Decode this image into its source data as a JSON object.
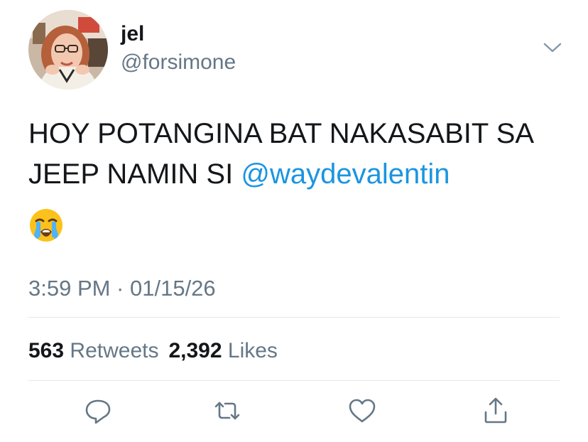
{
  "colors": {
    "text": "#14171a",
    "secondary": "#657786",
    "link": "#1b95e0",
    "divider": "#e1e8ed"
  },
  "author": {
    "display_name": "jel",
    "handle": "@forsimone",
    "avatar_icon": "profile-photo"
  },
  "tweet": {
    "text_before_mention": "HOY POTANGINA BAT NAKASABIT SA JEEP NAMIN SI ",
    "mention": "@waydevalentin",
    "emoji": "loudly-crying-face",
    "timestamp": "3:59 PM · 01/15/26"
  },
  "stats": {
    "retweets_count": "563",
    "retweets_label": "Retweets",
    "likes_count": "2,392",
    "likes_label": "Likes"
  },
  "actions": [
    {
      "name": "reply",
      "icon": "reply-icon"
    },
    {
      "name": "retweet",
      "icon": "retweet-icon"
    },
    {
      "name": "like",
      "icon": "heart-icon"
    },
    {
      "name": "share",
      "icon": "share-icon"
    }
  ],
  "menu": {
    "icon": "chevron-down-icon"
  }
}
